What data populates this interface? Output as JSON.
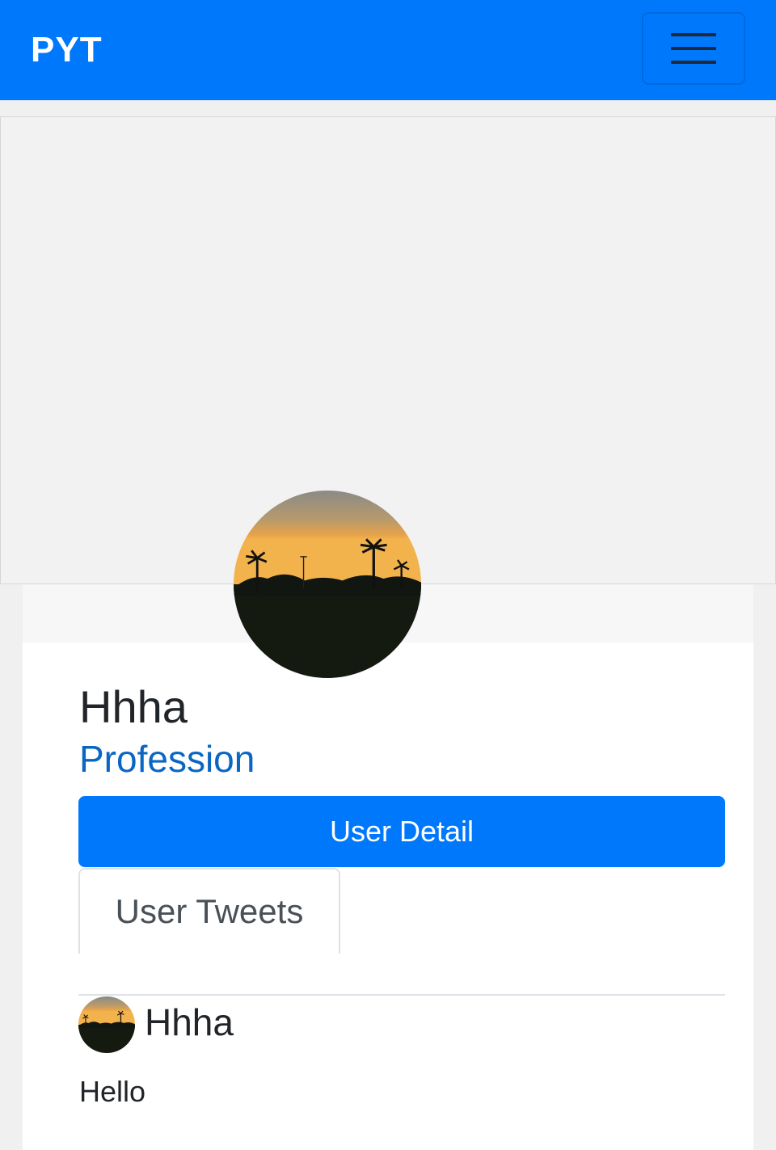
{
  "navbar": {
    "brand": "PYT",
    "color": "#0078fc",
    "toggler_icon": "hamburger-menu-icon"
  },
  "profile": {
    "name": "Hhha",
    "profession": "Profession"
  },
  "actions": {
    "user_detail_label": "User Detail",
    "user_tweets_tab_label": "User Tweets"
  },
  "tweets": [
    {
      "author": "Hhha",
      "text": "Hello"
    }
  ]
}
